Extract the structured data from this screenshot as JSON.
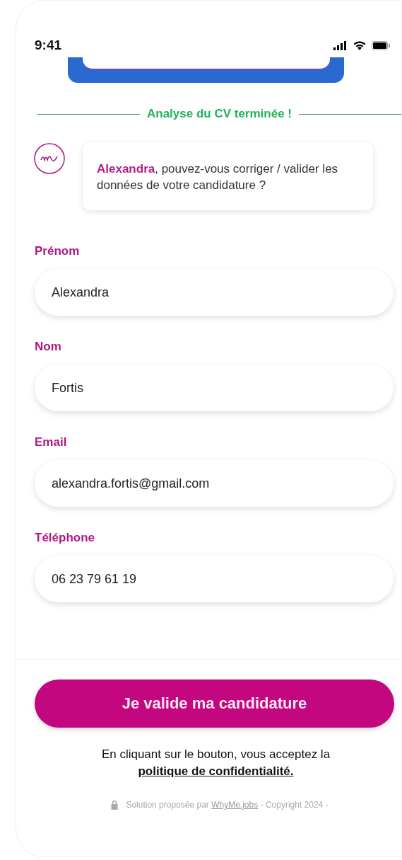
{
  "status_bar": {
    "time": "9:41"
  },
  "divider_label": "Analyse du CV terminée !",
  "message": {
    "text": "**Alexandra**, pouvez-vous corriger / valider les données de votre candidature ?"
  },
  "fields": [
    {
      "label": "Prénom",
      "value": "Alexandra"
    },
    {
      "label": "Nom",
      "value": "Fortis"
    },
    {
      "label": "Email",
      "value": "alexandra.fortis@gmail.com"
    },
    {
      "label": "Téléphone",
      "value": "06 23 79 61 19"
    }
  ],
  "submit_button": "Je valide ma candidature",
  "consent": {
    "text": "En cliquant sur le bouton, vous acceptez la",
    "link": "politique de confidentialité."
  },
  "footer": {
    "text": "Solution proposée par",
    "link": "WhyMe.jobs",
    "suffix": "- Copyright 2024 -"
  }
}
